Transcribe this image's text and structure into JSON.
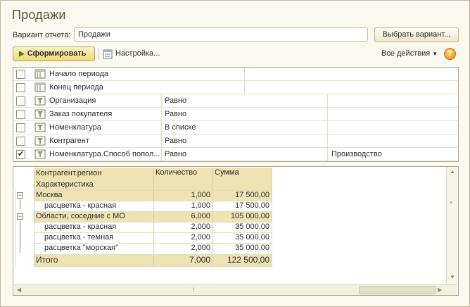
{
  "title": "Продажи",
  "variant": {
    "label": "Вариант отчета:",
    "value": "Продажи",
    "choose_button": "Выбрать вариант..."
  },
  "toolbar": {
    "generate_label": "Сформировать",
    "settings_label": "Настройка...",
    "all_actions_label": "Все действия",
    "help_label": "?"
  },
  "settings_rows": [
    {
      "checked": false,
      "name": "Начало периода",
      "condition": "",
      "value": ""
    },
    {
      "checked": false,
      "name": "Конец периода",
      "condition": "",
      "value": ""
    },
    {
      "checked": false,
      "name": "Организация",
      "condition": "Равно",
      "value": ""
    },
    {
      "checked": false,
      "name": "Заказ покупателя",
      "condition": "Равно",
      "value": ""
    },
    {
      "checked": false,
      "name": "Номенклатура",
      "condition": "В списке",
      "value": ""
    },
    {
      "checked": false,
      "name": "Контрагент",
      "condition": "Равно",
      "value": ""
    },
    {
      "checked": true,
      "name": "Номенклатура.Способ попол...",
      "condition": "Равно",
      "value": "Производство"
    }
  ],
  "report": {
    "headers": {
      "group1": "Контрагент.регион",
      "group2": "Характеристика",
      "qty": "Количество",
      "sum": "Сумма"
    },
    "rows": [
      {
        "level": 0,
        "name": "Москва",
        "qty": "1,000",
        "sum": "17 500,00"
      },
      {
        "level": 1,
        "name": "расцветка - красная",
        "qty": "1,000",
        "sum": "17 500,00"
      },
      {
        "level": 0,
        "name": "Области, соседние с МО",
        "qty": "6,000",
        "sum": "105 000,00"
      },
      {
        "level": 1,
        "name": "расцветка - красная",
        "qty": "2,000",
        "sum": "35 000,00"
      },
      {
        "level": 1,
        "name": "расцветка - темная",
        "qty": "2,000",
        "sum": "35 000,00"
      },
      {
        "level": 1,
        "name": "расцветка \"морская\"",
        "qty": "2,000",
        "sum": "35 000,00"
      }
    ],
    "total": {
      "label": "Итого",
      "qty": "7,000",
      "sum": "122 500,00"
    }
  },
  "colors": {
    "accent": "#efd976",
    "header_bg": "#efe3b4",
    "title": "#5c5436"
  }
}
